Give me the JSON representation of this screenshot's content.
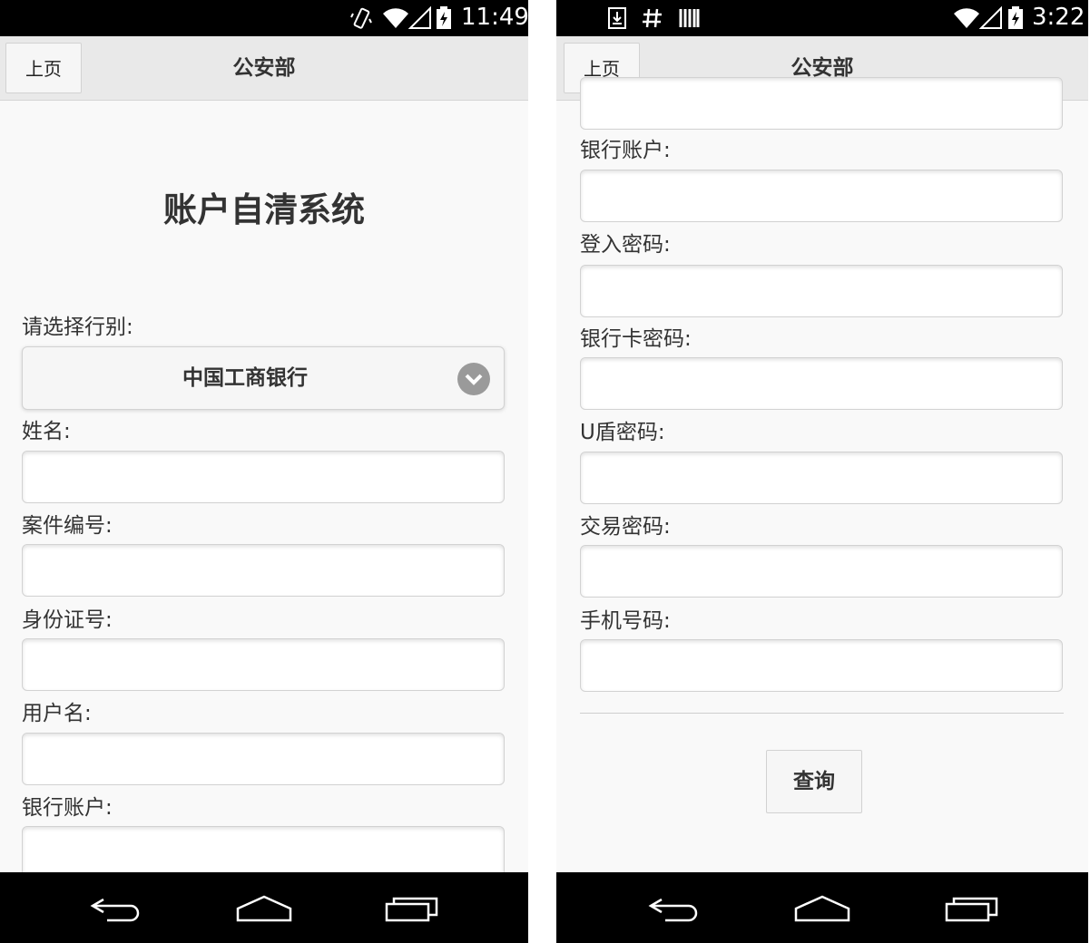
{
  "left": {
    "status_time": "11:49",
    "header": {
      "back_label": "上页",
      "title": "公安部"
    },
    "main_title": "账户自清系统",
    "bank_select_label": "请选择行别:",
    "bank_select_value": "中国工商银行",
    "fields": [
      {
        "label": "姓名:"
      },
      {
        "label": "案件编号:"
      },
      {
        "label": "身份证号:"
      },
      {
        "label": "用户名:"
      },
      {
        "label": "银行账户:"
      }
    ]
  },
  "right": {
    "status_time": "3:22",
    "header": {
      "back_label": "上页",
      "title": "公安部"
    },
    "fields": [
      {
        "label": "银行账户:"
      },
      {
        "label": "登入密码:"
      },
      {
        "label": "银行卡密码:"
      },
      {
        "label": "U盾密码:"
      },
      {
        "label": "交易密码:"
      },
      {
        "label": "手机号码:"
      }
    ],
    "query_label": "查询"
  },
  "colors": {
    "background": "#f9f9f9",
    "header": "#e9e9e9",
    "bars": "#000000",
    "text": "#333333"
  },
  "icons": [
    "vibrate-icon",
    "wifi-icon",
    "signal-icon",
    "battery-icon",
    "download-icon",
    "hash-icon",
    "barcode-icon",
    "chevron-down-icon",
    "back-icon",
    "home-icon",
    "recents-icon"
  ]
}
